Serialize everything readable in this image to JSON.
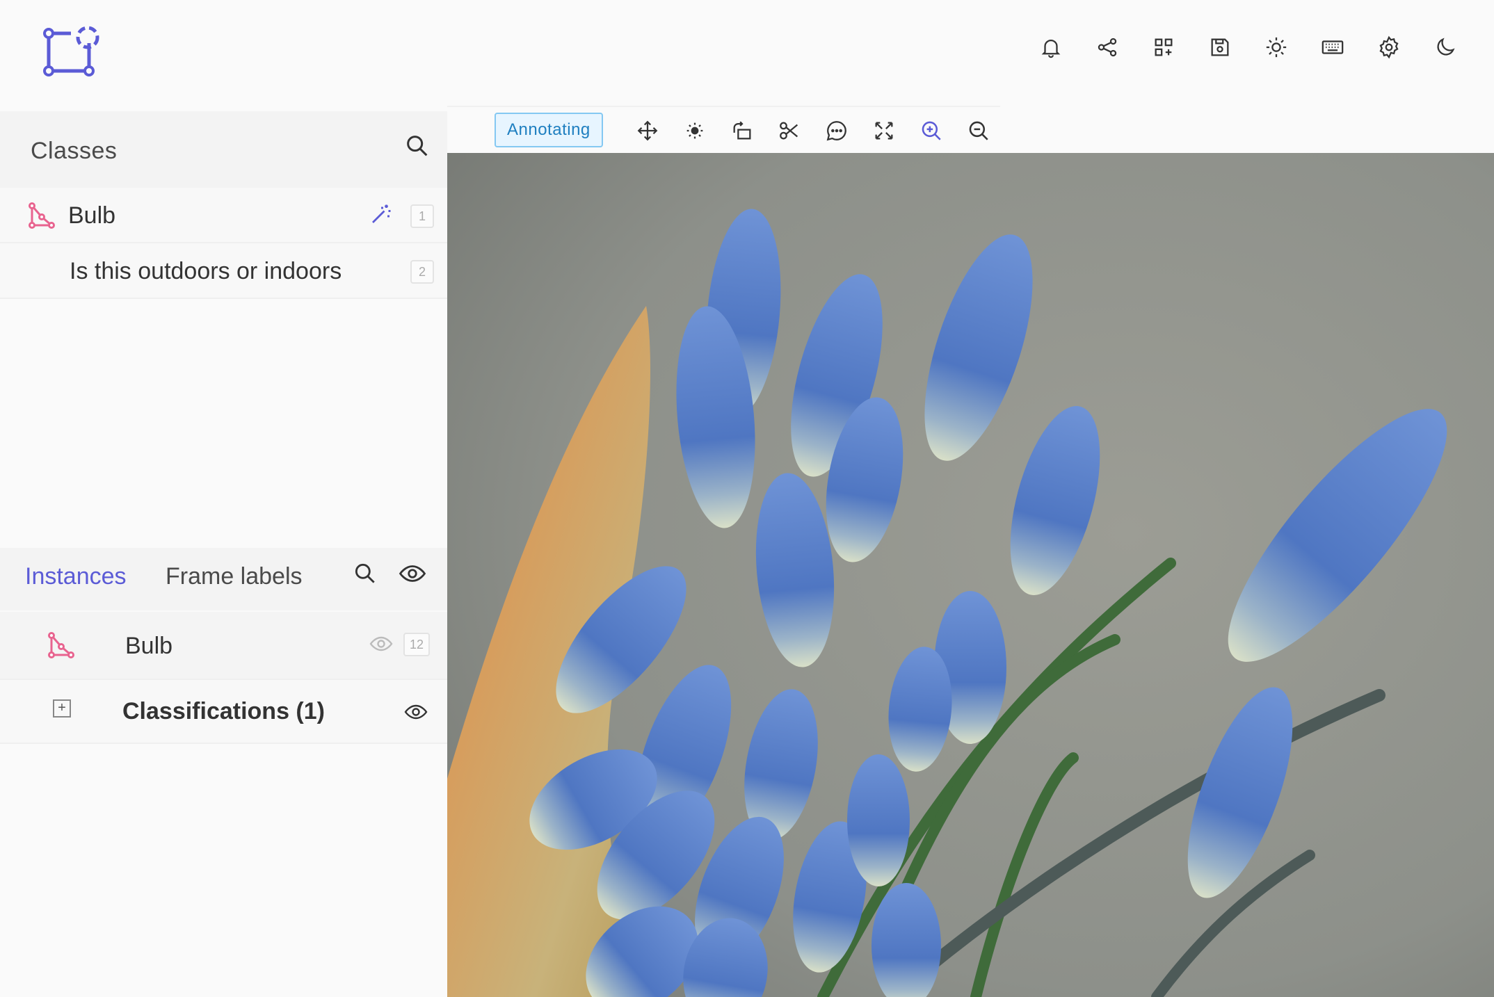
{
  "colors": {
    "accent": "#5b5bd6",
    "class_pink": "#e8638f",
    "mode_bg": "#e7f5ff",
    "mode_text": "#1f7fc0"
  },
  "header": {
    "logo": "label-tool-logo",
    "icons": [
      "bell-icon",
      "share-icon",
      "apps-icon",
      "save-icon",
      "brightness-icon",
      "keyboard-icon",
      "settings-icon",
      "dark-mode-icon"
    ]
  },
  "classes": {
    "title": "Classes",
    "items": [
      {
        "label": "Bulb",
        "shortcut": "1",
        "icon": "polygon-icon"
      },
      {
        "label": "Is this outdoors or indoors",
        "shortcut": "2"
      }
    ]
  },
  "toolbar": {
    "mode_label": "Annotating",
    "tools": [
      "move-icon",
      "brightness-tool-icon",
      "rotate-icon",
      "cut-icon",
      "comment-icon",
      "fit-screen-icon",
      "zoom-in-icon",
      "zoom-out-icon"
    ]
  },
  "instances": {
    "tabs": [
      "Instances",
      "Frame labels"
    ],
    "active_tab": "Instances",
    "items": [
      {
        "label": "Bulb",
        "count": "12"
      }
    ],
    "classifications_label": "Classifications (1)"
  }
}
